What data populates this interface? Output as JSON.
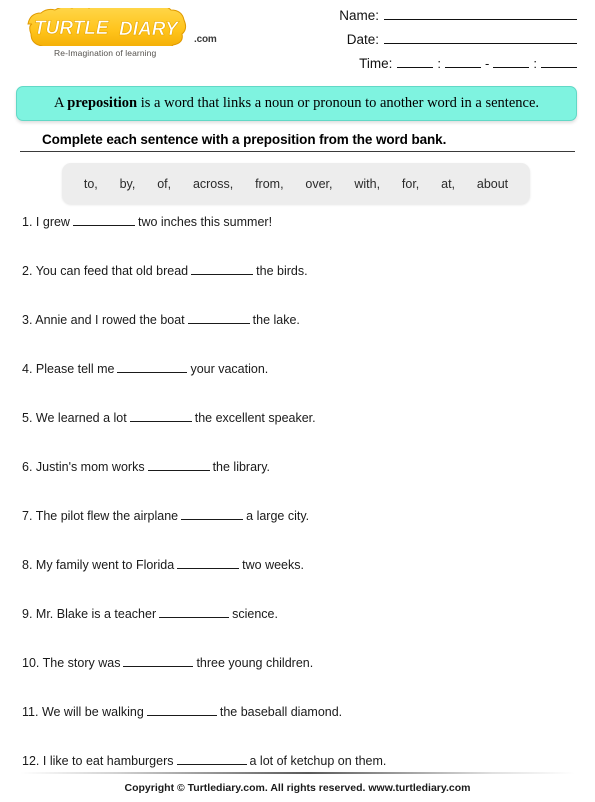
{
  "brand": {
    "logo_text": "TURTLE DIARY",
    "logo_suffix": ".com",
    "tagline": "Re-Imagination of learning",
    "logo_fill": "#FFFFFF",
    "logo_outline": "#F5B500",
    "logo_shadow": "#E09A00"
  },
  "header": {
    "name_label": "Name:",
    "date_label": "Date:",
    "time_label": "Time:",
    "time_sep_colon": ":",
    "time_sep_dash": "-"
  },
  "banner": {
    "prefix": "A ",
    "keyword": "preposition",
    "suffix": " is a word that links a noun or pronoun to another word in a sentence.",
    "background": "#7FF3E0",
    "border": "#62D8C6"
  },
  "instruction": {
    "text": "Complete each sentence with a preposition from the word bank."
  },
  "word_bank": {
    "background": "#EDEDED",
    "words": [
      "to,",
      "by,",
      "of,",
      "across,",
      "from,",
      "over,",
      "with,",
      "for,",
      "at,",
      "about"
    ]
  },
  "questions": [
    {
      "number": "1.",
      "before": "I grew",
      "after": "two inches this summer!",
      "blank": "w1"
    },
    {
      "number": "2.",
      "before": "You can feed that old bread",
      "after": "the birds.",
      "blank": "w1"
    },
    {
      "number": "3.",
      "before": "Annie and I rowed the boat",
      "after": "the lake.",
      "blank": "w1"
    },
    {
      "number": "4.",
      "before": "Please tell me",
      "after": "your vacation.",
      "blank": "w2"
    },
    {
      "number": "5.",
      "before": "We learned a lot",
      "after": "the excellent speaker.",
      "blank": "w1"
    },
    {
      "number": "6.",
      "before": "Justin's mom works",
      "after": "the library.",
      "blank": "w1"
    },
    {
      "number": "7.",
      "before": "The pilot flew the airplane",
      "after": "a large city.",
      "blank": "w1"
    },
    {
      "number": "8.",
      "before": "My family went to Florida",
      "after": "two weeks.",
      "blank": "w1"
    },
    {
      "number": "9.",
      "before": "Mr. Blake is a teacher",
      "after": "science.",
      "blank": "w2"
    },
    {
      "number": "10.",
      "before": "The story was",
      "after": "three young children.",
      "blank": "w2"
    },
    {
      "number": "11.",
      "before": "We will be walking",
      "after": "the baseball diamond.",
      "blank": "w2"
    },
    {
      "number": "12.",
      "before": "I like to eat hamburgers",
      "after": "a lot of ketchup on them.",
      "blank": "w2"
    }
  ],
  "footer": {
    "text": "Copyright © Turtlediary.com. All rights reserved. www.turtlediary.com"
  }
}
